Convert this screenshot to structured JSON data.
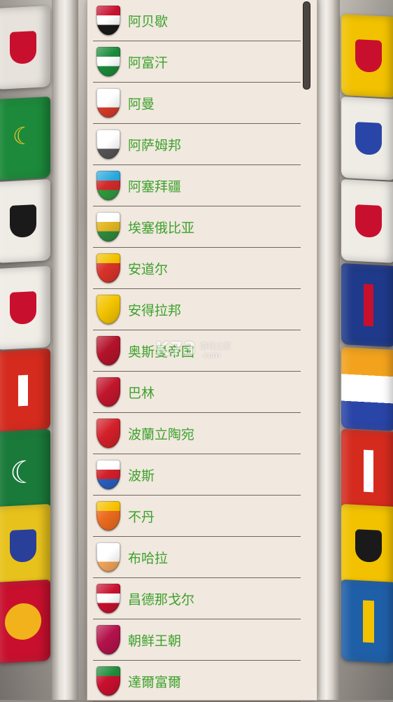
{
  "list": {
    "items": [
      {
        "label": "阿贝歇",
        "icon": "shield-flag-icon",
        "colors": [
          "#c8102e",
          "#ffffff",
          "#1a1a1a"
        ]
      },
      {
        "label": "阿富汗",
        "icon": "shield-flag-icon",
        "colors": [
          "#1b8a3a",
          "#ffffff",
          "#1b8a3a"
        ]
      },
      {
        "label": "阿曼",
        "icon": "shield-flag-icon",
        "colors": [
          "#ffffff",
          "#ffffff",
          "#d43a2a"
        ]
      },
      {
        "label": "阿萨姆邦",
        "icon": "shield-flag-icon",
        "colors": [
          "#ffffff",
          "#ffffff",
          "#555555"
        ]
      },
      {
        "label": "阿塞拜疆",
        "icon": "shield-flag-icon",
        "colors": [
          "#2aa9dd",
          "#d32a2a",
          "#2f9a3e"
        ]
      },
      {
        "label": "埃塞俄比亚",
        "icon": "shield-flag-icon",
        "colors": [
          "#ffffff",
          "#e2b624",
          "#2f8a3e"
        ]
      },
      {
        "label": "安道尔",
        "icon": "shield-flag-icon",
        "colors": [
          "#f2c200",
          "#d9332a",
          "#d9332a"
        ]
      },
      {
        "label": "安得拉邦",
        "icon": "shield-flag-icon",
        "colors": [
          "#f3c300",
          "#f3c300",
          "#f3c300"
        ]
      },
      {
        "label": "奥斯曼帝国",
        "icon": "shield-flag-icon",
        "colors": [
          "#b3132b",
          "#b3132b",
          "#b3132b"
        ]
      },
      {
        "label": "巴林",
        "icon": "shield-flag-icon",
        "colors": [
          "#c1162c",
          "#c1162c",
          "#c1162c"
        ]
      },
      {
        "label": "波蘭立陶宛",
        "icon": "shield-flag-icon",
        "colors": [
          "#d3202a",
          "#d3202a",
          "#d3202a"
        ]
      },
      {
        "label": "波斯",
        "icon": "shield-flag-icon",
        "colors": [
          "#ffffff",
          "#d3202a",
          "#2a5fbf"
        ]
      },
      {
        "label": "不丹",
        "icon": "shield-flag-icon",
        "colors": [
          "#f6c200",
          "#ec6b1f",
          "#ec6b1f"
        ]
      },
      {
        "label": "布哈拉",
        "icon": "shield-flag-icon",
        "colors": [
          "#ffffff",
          "#ffffff",
          "#f2a55a"
        ]
      },
      {
        "label": "昌德那戈尔",
        "icon": "shield-flag-icon",
        "colors": [
          "#c8102e",
          "#ffffff",
          "#c8102e"
        ]
      },
      {
        "label": "朝鲜王朝",
        "icon": "shield-flag-icon",
        "colors": [
          "#b3124a",
          "#b3124a",
          "#b3124a"
        ]
      },
      {
        "label": "達爾富爾",
        "icon": "shield-flag-icon",
        "colors": [
          "#1f8a3a",
          "#c8102e",
          "#c8102e"
        ]
      }
    ]
  },
  "watermark": {
    "brand": "K73",
    "line1": "游戏之家",
    "line2": ".com"
  }
}
